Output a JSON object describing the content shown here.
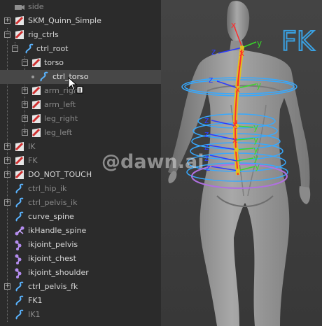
{
  "outliner": {
    "items": [
      {
        "label": "side",
        "color": "#8a8a8a",
        "icon": "camera-icon"
      },
      {
        "label": "SKM_Quinn_Simple",
        "color": "#d6d6d6",
        "icon": "transform-icon"
      },
      {
        "label": "rig_ctrls",
        "color": "#d6d6d6",
        "icon": "transform-icon"
      },
      {
        "label": "ctrl_root",
        "color": "#d6d6d6",
        "icon": "curve-icon"
      },
      {
        "label": "torso",
        "color": "#d6d6d6",
        "icon": "transform-icon"
      },
      {
        "label": "ctrl_torso",
        "color": "#e6e6e6",
        "icon": "curve-icon"
      },
      {
        "label": "arm_right",
        "color": "#8a8a8a",
        "icon": "transform-icon"
      },
      {
        "label": "arm_left",
        "color": "#8a8a8a",
        "icon": "transform-icon"
      },
      {
        "label": "leg_right",
        "color": "#8a8a8a",
        "icon": "transform-icon"
      },
      {
        "label": "leg_left",
        "color": "#8a8a8a",
        "icon": "transform-icon"
      },
      {
        "label": "IK",
        "color": "#8a8a8a",
        "icon": "transform-icon"
      },
      {
        "label": "FK",
        "color": "#8a8a8a",
        "icon": "transform-icon"
      },
      {
        "label": "DO_NOT_TOUCH",
        "color": "#d6d6d6",
        "icon": "transform-icon"
      },
      {
        "label": "ctrl_hip_ik",
        "color": "#8a8a8a",
        "icon": "curve-icon"
      },
      {
        "label": "ctrl_pelvis_ik",
        "color": "#8a8a8a",
        "icon": "curve-icon"
      },
      {
        "label": "curve_spine",
        "color": "#d6d6d6",
        "icon": "curve-icon"
      },
      {
        "label": "ikHandle_spine",
        "color": "#d6d6d6",
        "icon": "ik-handle-icon"
      },
      {
        "label": "ikjoint_pelvis",
        "color": "#d6d6d6",
        "icon": "joint-icon"
      },
      {
        "label": "ikjoint_chest",
        "color": "#d6d6d6",
        "icon": "joint-icon"
      },
      {
        "label": "ikjoint_shoulder",
        "color": "#d6d6d6",
        "icon": "joint-icon"
      },
      {
        "label": "ctrl_pelvis_fk",
        "color": "#d6d6d6",
        "icon": "curve-icon"
      },
      {
        "label": "FK1",
        "color": "#d6d6d6",
        "icon": "curve-icon"
      },
      {
        "label": "IK1",
        "color": "#8a8a8a",
        "icon": "curve-icon"
      }
    ]
  },
  "viewport": {
    "fk_label": "FK",
    "watermark": "@dawn.ai",
    "axis_x": "x",
    "axis_y": "y",
    "axis_z": "z",
    "colors": {
      "fk_label": "#3aa0e0",
      "control_curve": "#37a9ff",
      "pelvis_curve": "#b070e0",
      "axis_x": "#ff2a2a",
      "axis_y": "#39d82a",
      "axis_z": "#2c3cff",
      "spine_curve": "#e0c020"
    }
  }
}
